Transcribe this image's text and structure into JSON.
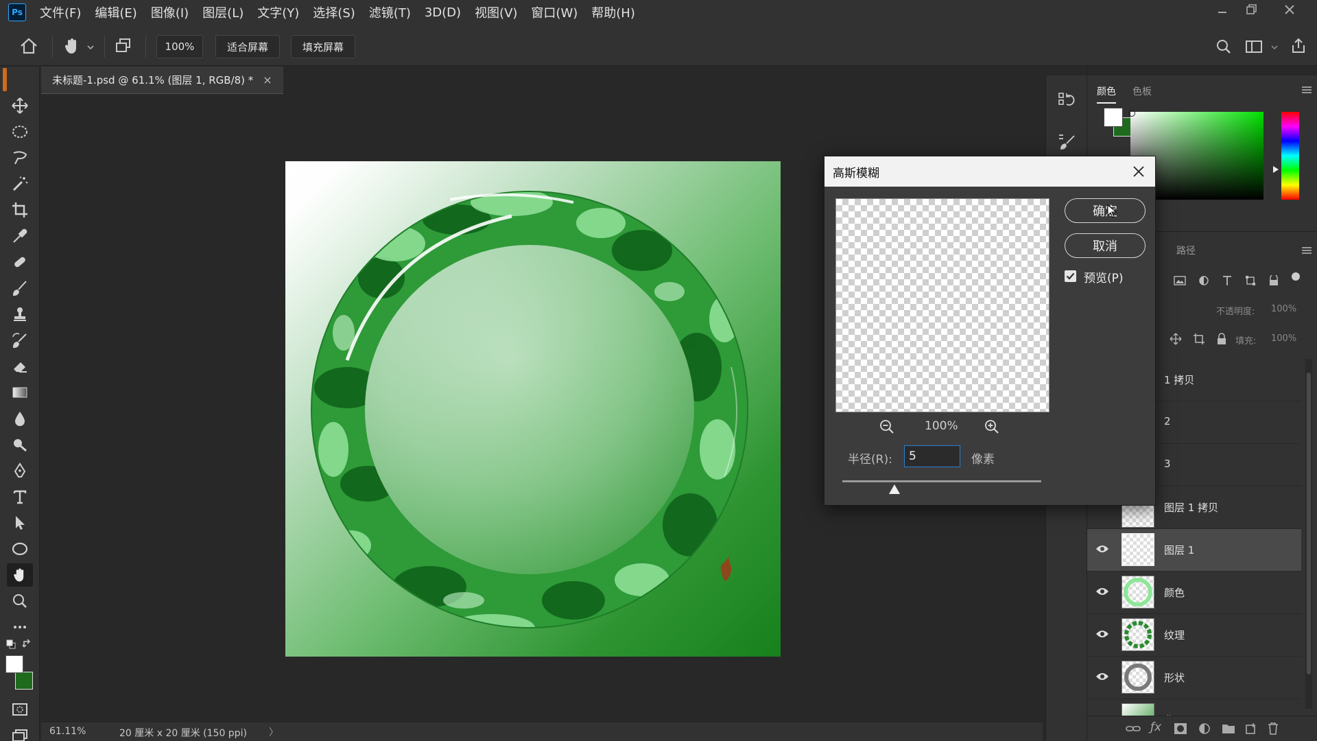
{
  "app": {
    "logo_text": "Ps"
  },
  "menu": [
    "文件(F)",
    "编辑(E)",
    "图像(I)",
    "图层(L)",
    "文字(Y)",
    "选择(S)",
    "滤镜(T)",
    "3D(D)",
    "视图(V)",
    "窗口(W)",
    "帮助(H)"
  ],
  "options_bar": {
    "zoom_value": "100%",
    "fit_screen_label": "适合屏幕",
    "fill_screen_label": "填充屏幕"
  },
  "document": {
    "tab_title": "未标题-1.psd @ 61.1% (图层 1, RGB/8) *",
    "tab_close": "×",
    "status_zoom": "61.11%",
    "status_doc_info": "20 厘米 x 20 厘米 (150 ppi)",
    "status_arrow": "〉"
  },
  "color_panel": {
    "tabs": [
      "颜色",
      "色板"
    ],
    "foreground": "#ffffff",
    "background": "#1e6b1e"
  },
  "layers_panel": {
    "tab": "路径",
    "opacity_label": "不透明度:",
    "opacity_value": "100%",
    "fill_label": "填充:",
    "fill_value": "100%",
    "layers": [
      {
        "name": "1 拷贝"
      },
      {
        "name": "2"
      },
      {
        "name": "3"
      },
      {
        "name": "图层 1 拷贝"
      },
      {
        "name": "图层 1",
        "selected": true
      },
      {
        "name": "颜色"
      },
      {
        "name": "纹理"
      },
      {
        "name": "形状"
      },
      {
        "name": "背景"
      }
    ]
  },
  "dialog": {
    "title": "高斯模糊",
    "ok_label": "确定",
    "cancel_label": "取消",
    "preview_label": "预览(P)",
    "preview_checked": true,
    "zoom_percent": "100%",
    "radius_label": "半径(R):",
    "radius_value": "5",
    "radius_unit": "像素"
  },
  "colors": {
    "accent": "#2a7fd8",
    "jade_dark": "#0f6a18",
    "jade_light": "#8ee49a"
  }
}
